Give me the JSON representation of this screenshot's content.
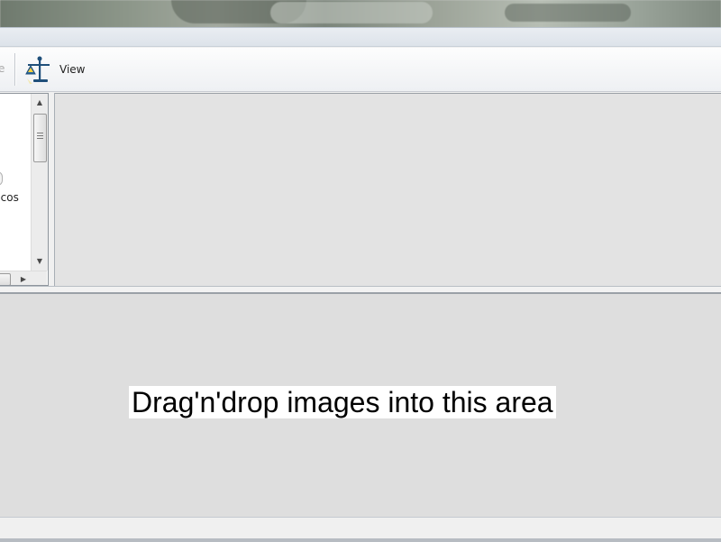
{
  "toolbar": {
    "clipped_label": "e",
    "view_label": "View",
    "view_icon": "measuring-scale-icon"
  },
  "tree": {
    "partial_item_label": "licos"
  },
  "drop_area": {
    "hint": "Drag'n'drop images into this area"
  },
  "colors": {
    "toolbar_icon": "#1f4f7a",
    "drop_background": "#dedede",
    "hint_background": "#ffffff"
  }
}
